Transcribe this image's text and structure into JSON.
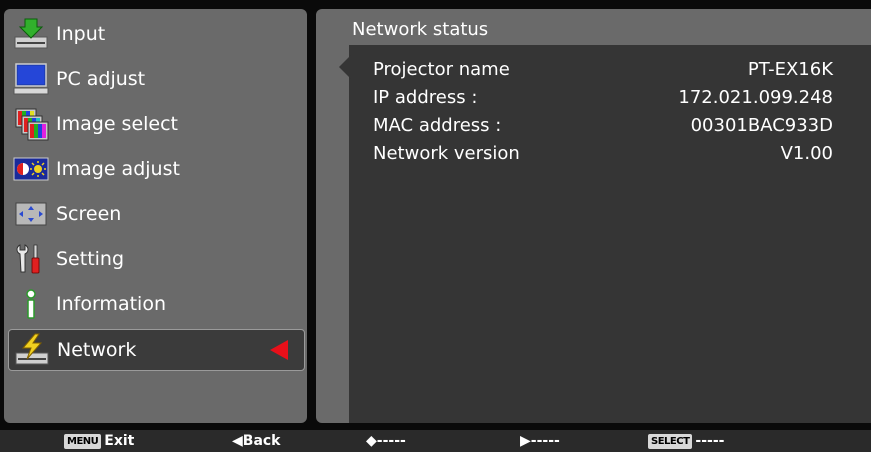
{
  "menu": {
    "items": [
      {
        "label": "Input",
        "icon": "input-icon"
      },
      {
        "label": "PC adjust",
        "icon": "pc-adjust-icon"
      },
      {
        "label": "Image select",
        "icon": "image-select-icon"
      },
      {
        "label": "Image adjust",
        "icon": "image-adjust-icon"
      },
      {
        "label": "Screen",
        "icon": "screen-icon"
      },
      {
        "label": "Setting",
        "icon": "setting-icon"
      },
      {
        "label": "Information",
        "icon": "information-icon"
      },
      {
        "label": "Network",
        "icon": "network-icon",
        "selected": true
      }
    ]
  },
  "panel": {
    "title": "Network status",
    "rows": [
      {
        "key": "Projector name",
        "value": "PT-EX16K"
      },
      {
        "key": "IP address :",
        "value": "172.021.099.248"
      },
      {
        "key": "MAC address :",
        "value": "00301BAC933D"
      },
      {
        "key": "Network version",
        "value": "V1.00"
      }
    ]
  },
  "footer": {
    "menu_key": "MENU",
    "menu_label": "Exit",
    "back_label": "◀Back",
    "updown_label": "◆-----",
    "right_label": "▶-----",
    "select_key": "SELECT",
    "select_label": "-----"
  },
  "colors": {
    "panel": "#6a6a6a",
    "content": "#353535",
    "selection_arrow": "#e8101a"
  }
}
